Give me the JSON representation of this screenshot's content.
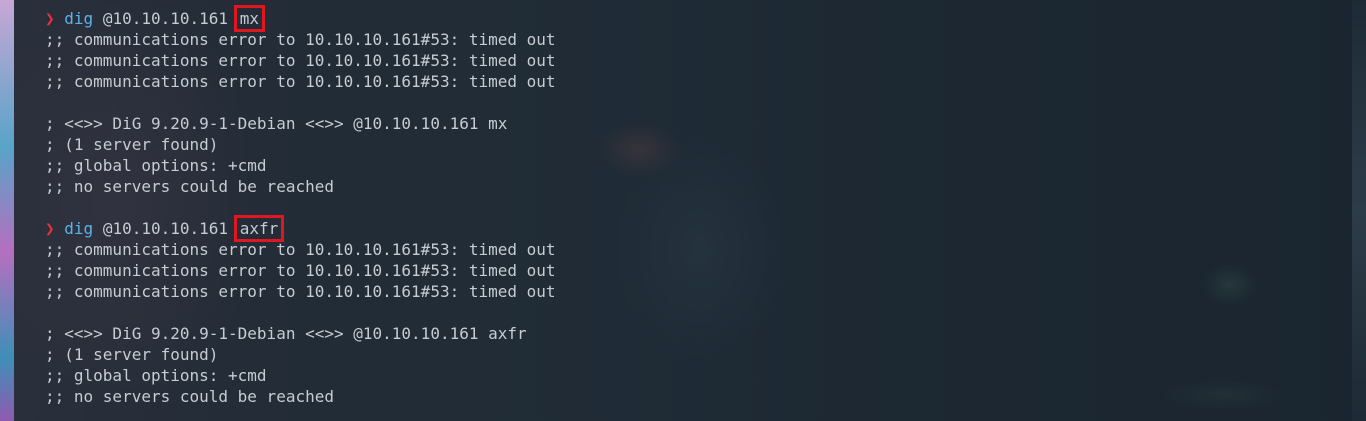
{
  "terminal": {
    "blocks": [
      {
        "prompt_symbol": "❯",
        "command": "dig",
        "server": "@10.10.10.161",
        "highlighted_arg": "mx",
        "errors": [
          ";; communications error to 10.10.10.161#53: timed out",
          ";; communications error to 10.10.10.161#53: timed out",
          ";; communications error to 10.10.10.161#53: timed out"
        ],
        "header": "; <<>> DiG 9.20.9-1-Debian <<>> @10.10.10.161 mx",
        "servers_found": "; (1 server found)",
        "global_options": ";; global options: +cmd",
        "result": ";; no servers could be reached"
      },
      {
        "prompt_symbol": "❯",
        "command": "dig",
        "server": "@10.10.10.161",
        "highlighted_arg": "axfr",
        "errors": [
          ";; communications error to 10.10.10.161#53: timed out",
          ";; communications error to 10.10.10.161#53: timed out",
          ";; communications error to 10.10.10.161#53: timed out"
        ],
        "header": "; <<>> DiG 9.20.9-1-Debian <<>> @10.10.10.161 axfr",
        "servers_found": "; (1 server found)",
        "global_options": ";; global options: +cmd",
        "result": ";; no servers could be reached"
      }
    ],
    "colors": {
      "prompt_arrow": "#e8303f",
      "command": "#59b4e6",
      "output_text": "#c6ccd2",
      "highlight_box": "#e01620"
    }
  }
}
